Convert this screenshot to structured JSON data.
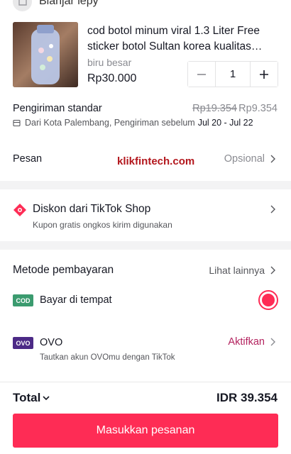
{
  "store": {
    "name": "Bianjar lepy",
    "icon": "store-icon"
  },
  "product": {
    "title": "cod botol minum viral 1.3 Liter  Free sticker botol Sultan korea kualitas premium",
    "variant": "biru besar",
    "price": "Rp30.000",
    "quantity": "1",
    "decrease_icon": "minus-icon",
    "increase_icon": "plus-icon"
  },
  "shipping": {
    "label": "Pengiriman standar",
    "original_price": "Rp19.354",
    "price": "Rp9.354",
    "info": "Dari Kota Palembang, Pengiriman sebelum",
    "dates": "Jul 20 - Jul 22",
    "icon": "truck-icon"
  },
  "message": {
    "label": "Pesan",
    "placeholder": "Opsional"
  },
  "watermark": "klikfintech.com",
  "discount": {
    "title": "Diskon dari TikTok Shop",
    "subtitle": "Kupon gratis ongkos kirim digunakan",
    "icon": "coupon-icon"
  },
  "payment": {
    "title": "Metode pembayaran",
    "more": "Lihat lainnya",
    "methods": [
      {
        "badge": "COD",
        "label": "Bayar di tempat",
        "selected": true,
        "color": "#3b9b6f"
      },
      {
        "badge": "OVO",
        "label": "OVO",
        "subtitle": "Tautkan akun OVOmu dengan TikTok",
        "action": "Aktifkan",
        "color": "#4c2a86"
      }
    ]
  },
  "footer": {
    "total_label": "Total",
    "total_value": "IDR 39.354",
    "order_button": "Masukkan pesanan"
  },
  "colors": {
    "accent": "#fe2c55",
    "activate": "#b3225e",
    "watermark": "#b3171d"
  }
}
